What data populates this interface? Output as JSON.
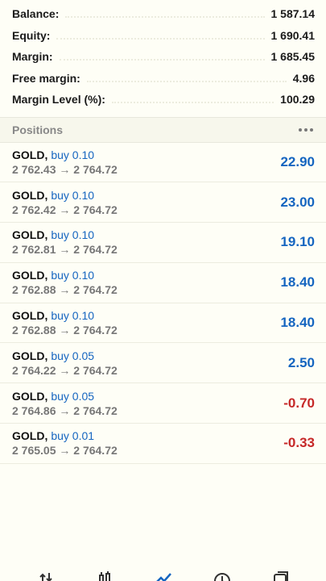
{
  "summary": [
    {
      "label": "Balance:",
      "value": "1 587.14"
    },
    {
      "label": "Equity:",
      "value": "1 690.41"
    },
    {
      "label": "Margin:",
      "value": "1 685.45"
    },
    {
      "label": "Free margin:",
      "value": "4.96"
    },
    {
      "label": "Margin Level (%):",
      "value": "100.29"
    }
  ],
  "positions_header": {
    "title": "Positions",
    "menu_icon": "more-horizontal-icon"
  },
  "positions": [
    {
      "symbol": "GOLD,",
      "side": "buy 0.10",
      "prices": "2 762.43 → 2 764.72",
      "profit": "22.90",
      "sign": "pos"
    },
    {
      "symbol": "GOLD,",
      "side": "buy 0.10",
      "prices": "2 762.42 → 2 764.72",
      "profit": "23.00",
      "sign": "pos"
    },
    {
      "symbol": "GOLD,",
      "side": "buy 0.10",
      "prices": "2 762.81 → 2 764.72",
      "profit": "19.10",
      "sign": "pos"
    },
    {
      "symbol": "GOLD,",
      "side": "buy 0.10",
      "prices": "2 762.88 → 2 764.72",
      "profit": "18.40",
      "sign": "pos"
    },
    {
      "symbol": "GOLD,",
      "side": "buy 0.10",
      "prices": "2 762.88 → 2 764.72",
      "profit": "18.40",
      "sign": "pos"
    },
    {
      "symbol": "GOLD,",
      "side": "buy 0.05",
      "prices": "2 764.22 → 2 764.72",
      "profit": "2.50",
      "sign": "pos"
    },
    {
      "symbol": "GOLD,",
      "side": "buy 0.05",
      "prices": "2 764.86 → 2 764.72",
      "profit": "-0.70",
      "sign": "neg"
    },
    {
      "symbol": "GOLD,",
      "side": "buy 0.01",
      "prices": "2 765.05 → 2 764.72",
      "profit": "-0.33",
      "sign": "neg"
    }
  ],
  "bottom_nav": [
    {
      "name": "quotes-icon"
    },
    {
      "name": "chart-icon"
    },
    {
      "name": "trade-icon"
    },
    {
      "name": "history-icon"
    },
    {
      "name": "messages-icon"
    }
  ],
  "colors": {
    "profit": "#1565c0",
    "loss": "#c62828",
    "background": "#fefef6"
  }
}
